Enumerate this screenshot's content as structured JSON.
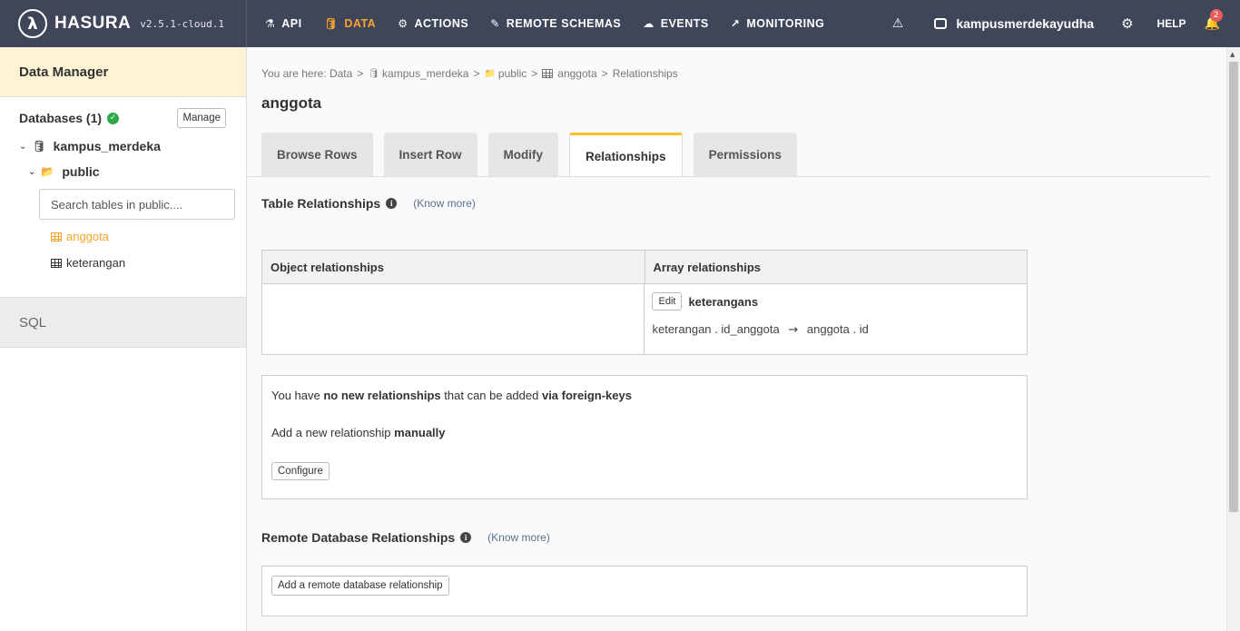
{
  "brand": {
    "logo_glyph": "λ",
    "name": "HASURA",
    "version": "v2.5.1-cloud.1"
  },
  "nav": [
    {
      "label": "API",
      "icon": "flask-icon",
      "glyph": "⚗",
      "active": false
    },
    {
      "label": "DATA",
      "icon": "database-icon",
      "glyph": "🛢",
      "active": true
    },
    {
      "label": "ACTIONS",
      "icon": "cogs-icon",
      "glyph": "⚙",
      "active": false
    },
    {
      "label": "REMOTE SCHEMAS",
      "icon": "plug-icon",
      "glyph": "✎",
      "active": false
    },
    {
      "label": "EVENTS",
      "icon": "cloud-icon",
      "glyph": "☁",
      "active": false
    },
    {
      "label": "MONITORING",
      "icon": "chart-line-icon",
      "glyph": "↗",
      "active": false
    }
  ],
  "header_right": {
    "warning_glyph": "⚠",
    "project_name": "kampusmerdekayudha",
    "settings_glyph": "⚙",
    "help_label": "HELP",
    "bell_glyph": "🔔",
    "notification_count": "2"
  },
  "sidebar": {
    "title": "Data Manager",
    "databases_label": "Databases (1)",
    "check_glyph": "✓",
    "manage_label": "Manage",
    "chevron_glyph": "⌄",
    "database_name": "kampus_merdeka",
    "schema_name": "public",
    "search_placeholder": "Search tables in public....",
    "tables": [
      "anggota",
      "keterangan"
    ],
    "sql_label": "SQL"
  },
  "breadcrumb": {
    "prefix": "You are here:",
    "items": [
      "Data",
      "kampus_merdeka",
      "public",
      "anggota",
      "Relationships"
    ],
    "separator": ">"
  },
  "page_title": "anggota",
  "tabs": [
    "Browse Rows",
    "Insert Row",
    "Modify",
    "Relationships",
    "Permissions"
  ],
  "table_relationships": {
    "title": "Table Relationships",
    "know_more": "(Know more)",
    "object_header": "Object relationships",
    "array_header": "Array relationships",
    "edit_label": "Edit",
    "relationship_name": "keterangans",
    "mapping_from": "keterangan . id_anggota",
    "mapping_arrow": "→",
    "mapping_to": "anggota . id"
  },
  "fk_box": {
    "line1_a": "You have ",
    "line1_b": "no new relationships",
    "line1_c": " that can be added ",
    "line1_d": "via foreign-keys",
    "line2_a": "Add a new relationship ",
    "line2_b": "manually",
    "configure_label": "Configure"
  },
  "remote": {
    "title": "Remote Database Relationships",
    "know_more": "(Know more)",
    "add_label": "Add a remote database relationship"
  },
  "colors": {
    "topbar": "#3f4659",
    "accent": "#f8a42b",
    "sidebar_header": "#fff3d5",
    "success": "#2ea84a",
    "badge": "#e85b5b"
  }
}
